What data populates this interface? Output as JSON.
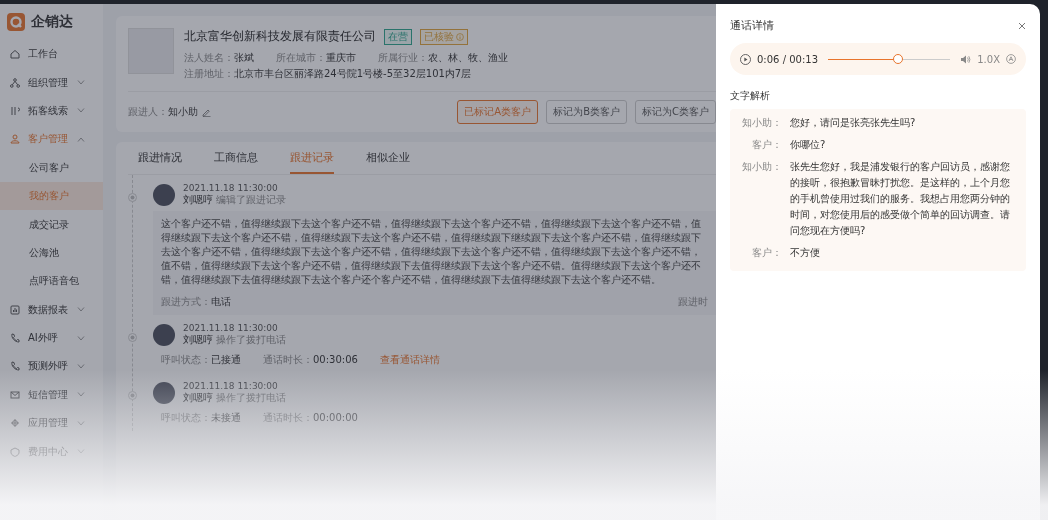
{
  "app": {
    "name": "企销达"
  },
  "sidebar": {
    "items": [
      {
        "label": "工作台",
        "selected": false
      },
      {
        "label": "组织管理",
        "selected": false,
        "expanded": false
      },
      {
        "label": "拓客线索",
        "selected": false,
        "expanded": false
      },
      {
        "label": "客户管理",
        "selected": true,
        "expanded": true,
        "children": [
          {
            "label": "公司客户",
            "selected": false
          },
          {
            "label": "我的客户",
            "selected": true
          },
          {
            "label": "成交记录",
            "selected": false
          },
          {
            "label": "公海池",
            "selected": false
          },
          {
            "label": "点呼语音包",
            "selected": false
          }
        ]
      },
      {
        "label": "数据报表",
        "selected": false,
        "expanded": false
      },
      {
        "label": "AI外呼",
        "selected": false,
        "expanded": false
      },
      {
        "label": "预测外呼",
        "selected": false,
        "expanded": false
      },
      {
        "label": "短信管理",
        "selected": false,
        "expanded": false
      },
      {
        "label": "应用管理",
        "selected": false,
        "expanded": false
      },
      {
        "label": "费用中心",
        "selected": false,
        "expanded": false
      }
    ]
  },
  "company": {
    "name": "北京富华创新科技发展有限责任公司",
    "tags": [
      {
        "label": "在营",
        "kind": "status"
      },
      {
        "label": "已核验",
        "kind": "verified"
      }
    ],
    "info": [
      {
        "label": "法人姓名：",
        "value": "张斌"
      },
      {
        "label": "所在城市：",
        "value": "重庆市"
      },
      {
        "label": "所属行业：",
        "value": "农、林、牧、渔业"
      },
      {
        "label": "注册地址：",
        "value": "北京市丰台区丽泽路24号院1号楼-5至32层101内7层"
      }
    ],
    "follower": {
      "label": "跟进人：",
      "value": "知小助"
    },
    "buttons": [
      {
        "label": "已标记A类客户",
        "selected": true
      },
      {
        "label": "标记为B类客户",
        "selected": false
      },
      {
        "label": "标记为C类客户",
        "selected": false
      }
    ]
  },
  "tabs": [
    {
      "label": "跟进情况",
      "selected": false
    },
    {
      "label": "工商信息",
      "selected": false
    },
    {
      "label": "跟进记录",
      "selected": true
    },
    {
      "label": "相似企业",
      "selected": false
    }
  ],
  "timeline": [
    {
      "kind": "note",
      "time": "2021.11.18  11:30:00",
      "author": "刘嗯哼",
      "action": "编辑了跟进记录",
      "content": "这个客户还不错，值得继续跟下去这个客户还不错，值得继续跟下去这个客户还不错，值得继续跟下去这个客户还不错，值得继续跟下去这个客户还不错，值得继续跟下去这个客户还不错，值得继续跟下继续跟下去这个客户还不错，值得继续跟下去这个客户还不错，值得继续跟下去这个客户还不错，值得继续跟下去这个客户还不错，值得继续跟下去这个客户还不错，值不错，值得继续跟下去这个客户还不错，值得继续跟下去值得继续跟下去这个客户还不错。值得继续跟下去这个客户还不错，值得继续跟下去值得继续跟下去这个客户还个客户还不错，值得继续跟下去值得继续跟下去这个客户还不错。",
      "method_label": "跟进方式：",
      "method": "电话",
      "extra": "跟进时"
    },
    {
      "kind": "call",
      "time": "2021.11.18  11:30:00",
      "author": "刘嗯哼",
      "action": "操作了拨打电话",
      "status_label": "呼叫状态：",
      "status": "已接通",
      "duration_label": "通话时长：",
      "duration": "00:30:06",
      "link": "查看通话详情"
    },
    {
      "kind": "call",
      "time": "2021.11.18  11:30:00",
      "author": "刘嗯哼",
      "action": "操作了拨打电话",
      "status_label": "呼叫状态：",
      "status": "未接通",
      "duration_label": "通话时长：",
      "duration": "00:00:00"
    }
  ],
  "drawer": {
    "title": "通话详情",
    "player": {
      "time": "0:06 / 00:13",
      "level": 0.57,
      "speed": "1.0X"
    },
    "section_title": "文字解析",
    "transcript": [
      {
        "speaker": "知小助：",
        "text": "您好，请问是张亮张先生吗?"
      },
      {
        "speaker": "客户：",
        "text": "你哪位?"
      },
      {
        "speaker": "知小助：",
        "text": "张先生您好，我是浦发银行的客户回访员，感谢您的接听，很抱歉冒昧打扰您。是这样的，上个月您的手机曾使用过我们的服务。我想占用您两分钟的时间，对您使用后的感受做个简单的回访调查。请问您现在方便吗?"
      },
      {
        "speaker": "客户：",
        "text": "不方便"
      }
    ]
  }
}
